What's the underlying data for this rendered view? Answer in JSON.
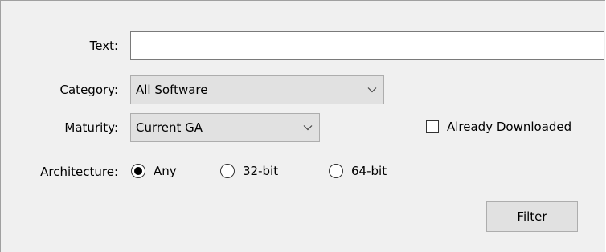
{
  "form": {
    "text_label": "Text:",
    "text_value": "",
    "text_placeholder": "",
    "category_label": "Category:",
    "category_value": "All Software",
    "maturity_label": "Maturity:",
    "maturity_value": "Current GA",
    "already_downloaded_label": "Already Downloaded",
    "already_downloaded_checked": false,
    "architecture_label": "Architecture:",
    "architecture_options": [
      {
        "label": "Any",
        "checked": true
      },
      {
        "label": "32-bit",
        "checked": false
      },
      {
        "label": "64-bit",
        "checked": false
      }
    ],
    "filter_button_label": "Filter"
  },
  "icons": {
    "dropdown": "chevron-down-icon"
  },
  "colors": {
    "panel_background": "#f0f0f0",
    "control_background": "#e1e1e1",
    "control_border": "#adadad",
    "input_border": "#7a7a7a"
  }
}
